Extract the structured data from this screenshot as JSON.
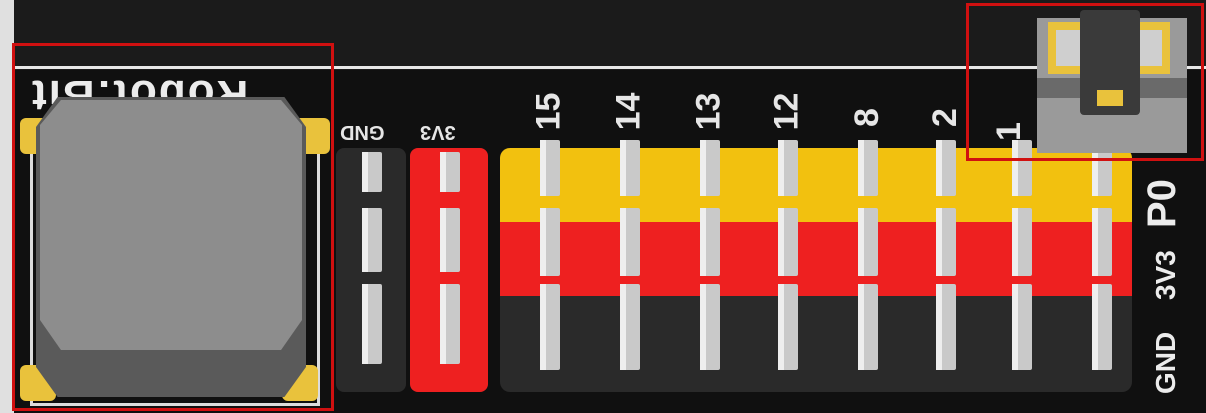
{
  "board": {
    "silkscreen_title": "Robot:Bit",
    "left_header_labels": [
      "GND",
      "3V3"
    ],
    "pin_numbers": [
      "15",
      "14",
      "13",
      "12",
      "8",
      "2",
      "1"
    ],
    "row_labels": [
      "P0",
      "3V3",
      "GND"
    ]
  },
  "components": {
    "buzzer": {
      "name": "buzzer"
    },
    "jumper": {
      "name": "jumper"
    }
  },
  "colors": {
    "yellow_row": "#f2c10f",
    "red_row": "#ee2020",
    "black_row": "#2a2a2a",
    "highlight": "#d01010",
    "pad_gold": "#e9c23c"
  }
}
